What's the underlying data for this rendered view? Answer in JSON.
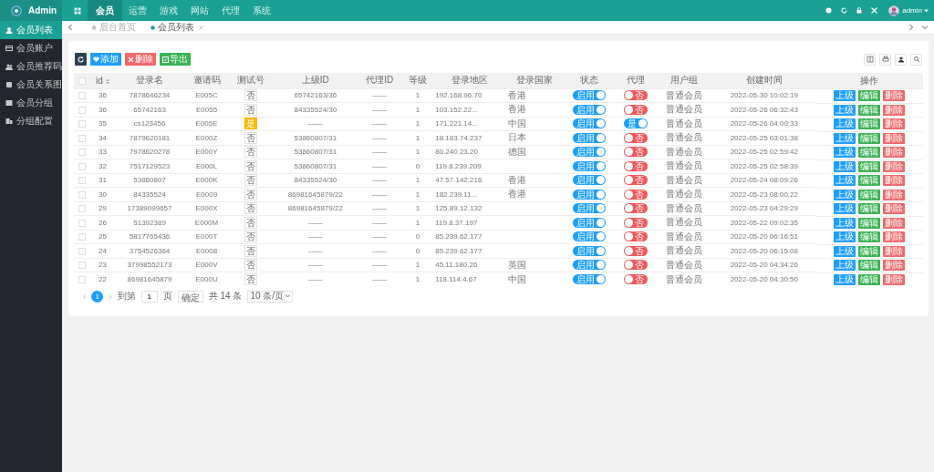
{
  "brand": {
    "title": "Admin"
  },
  "top_nav": [
    {
      "kind": "icon",
      "selected": false
    },
    {
      "label": "会员",
      "selected": true
    },
    {
      "label": "运营",
      "selected": false
    },
    {
      "label": "游戏",
      "selected": false
    },
    {
      "label": "网站",
      "selected": false
    },
    {
      "label": "代理",
      "selected": false
    },
    {
      "label": "系统",
      "selected": false
    }
  ],
  "user": {
    "name": "admin"
  },
  "sidebar": {
    "items": [
      {
        "label": "会员列表",
        "selected": true
      },
      {
        "label": "会员账户",
        "selected": false
      },
      {
        "label": "会员推荐码",
        "selected": false
      },
      {
        "label": "会员关系图",
        "selected": false
      },
      {
        "label": "会员分组",
        "selected": false
      },
      {
        "label": "分组配置",
        "selected": false
      }
    ]
  },
  "page_tabs": [
    {
      "label": "后台首页",
      "selected": false,
      "closable": false
    },
    {
      "label": "会员列表",
      "selected": true,
      "closable": true
    }
  ],
  "toolbar": [
    {
      "kind": "refresh"
    },
    {
      "kind": "primary",
      "label": "添加"
    },
    {
      "kind": "danger",
      "label": "删除"
    },
    {
      "kind": "success",
      "label": "导出"
    }
  ],
  "table": {
    "columns": [
      "id",
      "登录名",
      "邀请码",
      "测试号",
      "上级ID",
      "代理ID",
      "等级",
      "登录地区",
      "登录国家",
      "状态",
      "代理",
      "用户组",
      "创建时间",
      "操作"
    ],
    "header_checked": false,
    "rows": [
      {
        "checked": false,
        "id": "36",
        "login": "7878646234",
        "invite": "E005C",
        "test": {
          "text": "否",
          "on": false
        },
        "parent": "65742163/36",
        "agent_id": "——",
        "level": "1",
        "ip": "192.168.96.70",
        "country": "香港",
        "status": {
          "text": "启用",
          "on": true
        },
        "agent": {
          "text": "否",
          "on": false
        },
        "group": "普通会员",
        "created": "2022-05-30 10:02:19",
        "actions": [
          "上级",
          "编辑",
          "删除"
        ]
      },
      {
        "checked": false,
        "id": "36",
        "login": "65742163",
        "invite": "E0055",
        "test": {
          "text": "否",
          "on": false
        },
        "parent": "84335524/30",
        "agent_id": "——",
        "level": "1",
        "ip": "103.152.22...",
        "country": "香港",
        "status": {
          "text": "启用",
          "on": true
        },
        "agent": {
          "text": "否",
          "on": false
        },
        "group": "普通会员",
        "created": "2022-05-26 06:32:43",
        "actions": [
          "上级",
          "编辑",
          "删除"
        ]
      },
      {
        "checked": false,
        "id": "35",
        "login": "cs123456",
        "invite": "E005E",
        "test": {
          "text": "是",
          "on": true
        },
        "parent": "——",
        "agent_id": "——",
        "level": "1",
        "ip": "171.221.14...",
        "country": "中国",
        "status": {
          "text": "启用",
          "on": true
        },
        "agent": {
          "text": "是",
          "on": true
        },
        "group": "普通会员",
        "created": "2022-05-26 04:00:33",
        "actions": [
          "上级",
          "编辑",
          "删除"
        ]
      },
      {
        "checked": false,
        "id": "34",
        "login": "7879620181",
        "invite": "E000Z",
        "test": {
          "text": "否",
          "on": false
        },
        "parent": "53860807/31",
        "agent_id": "——",
        "level": "1",
        "ip": "18.183.74.237",
        "country": "日本",
        "status": {
          "text": "启用",
          "on": true
        },
        "agent": {
          "text": "否",
          "on": false
        },
        "group": "普通会员",
        "created": "2022-05-25 03:01:38",
        "actions": [
          "上级",
          "编辑",
          "删除"
        ]
      },
      {
        "checked": false,
        "id": "33",
        "login": "7978620278",
        "invite": "E000Y",
        "test": {
          "text": "否",
          "on": false
        },
        "parent": "53860807/31",
        "agent_id": "——",
        "level": "1",
        "ip": "80.240.23.20",
        "country": "德国",
        "status": {
          "text": "启用",
          "on": true
        },
        "agent": {
          "text": "否",
          "on": false
        },
        "group": "普通会员",
        "created": "2022-05-25 02:59:42",
        "actions": [
          "上级",
          "编辑",
          "删除"
        ]
      },
      {
        "checked": false,
        "id": "32",
        "login": "7517129523",
        "invite": "E000L",
        "test": {
          "text": "否",
          "on": false
        },
        "parent": "53860807/31",
        "agent_id": "——",
        "level": "0",
        "ip": "119.8.239.209",
        "status": {
          "text": "启用",
          "on": true
        },
        "agent": {
          "text": "否",
          "on": false
        },
        "group": "普通会员",
        "created": "2022-05-25 02:58:39",
        "actions": [
          "上级",
          "编辑",
          "删除"
        ]
      },
      {
        "checked": false,
        "id": "31",
        "login": "53860807",
        "invite": "E000K",
        "test": {
          "text": "否",
          "on": false
        },
        "parent": "84335524/30",
        "agent_id": "——",
        "level": "1",
        "ip": "47.57.142.216",
        "country": "香港",
        "status": {
          "text": "启用",
          "on": true
        },
        "agent": {
          "text": "否",
          "on": false
        },
        "group": "普通会员",
        "created": "2022-05-24 08:09:26",
        "actions": [
          "上级",
          "编辑",
          "删除"
        ]
      },
      {
        "checked": false,
        "id": "30",
        "login": "84335524",
        "invite": "E0009",
        "test": {
          "text": "否",
          "on": false
        },
        "parent": "86981645879/22",
        "agent_id": "——",
        "level": "1",
        "ip": "182.239.11...",
        "country": "香港",
        "status": {
          "text": "启用",
          "on": true
        },
        "agent": {
          "text": "否",
          "on": false
        },
        "group": "普通会员",
        "created": "2022-05-23 08:00:22",
        "actions": [
          "上级",
          "编辑",
          "删除"
        ]
      },
      {
        "checked": false,
        "id": "29",
        "login": "17389099657",
        "invite": "E000X",
        "test": {
          "text": "否",
          "on": false
        },
        "parent": "86981645879/22",
        "agent_id": "——",
        "level": "1",
        "ip": "125.89.12.132",
        "status": {
          "text": "启用",
          "on": true
        },
        "agent": {
          "text": "否",
          "on": false
        },
        "group": "普通会员",
        "created": "2022-05-23 04:29:29",
        "actions": [
          "上级",
          "编辑",
          "删除"
        ]
      },
      {
        "checked": false,
        "id": "26",
        "login": "51392389",
        "invite": "E000M",
        "test": {
          "text": "否",
          "on": false
        },
        "parent": "——",
        "agent_id": "——",
        "level": "1",
        "ip": "119.8.37.197",
        "status": {
          "text": "启用",
          "on": true
        },
        "agent": {
          "text": "否",
          "on": false
        },
        "group": "普通会员",
        "created": "2022-05-22 09:02:35",
        "actions": [
          "上级",
          "编辑",
          "删除"
        ]
      },
      {
        "checked": false,
        "id": "25",
        "login": "5817765436",
        "invite": "E000T",
        "test": {
          "text": "否",
          "on": false
        },
        "parent": "——",
        "agent_id": "——",
        "level": "0",
        "ip": "85.239.62.177",
        "status": {
          "text": "启用",
          "on": true
        },
        "agent": {
          "text": "否",
          "on": false
        },
        "group": "普通会员",
        "created": "2022-05-20 06:16:51",
        "actions": [
          "上级",
          "编辑",
          "删除"
        ]
      },
      {
        "checked": false,
        "id": "24",
        "login": "3754526364",
        "invite": "E0008",
        "test": {
          "text": "否",
          "on": false
        },
        "parent": "——",
        "agent_id": "——",
        "level": "0",
        "ip": "85.239.62.177",
        "status": {
          "text": "启用",
          "on": true
        },
        "agent": {
          "text": "否",
          "on": false
        },
        "group": "普通会员",
        "created": "2022-05-20 06:15:08",
        "actions": [
          "上级",
          "编辑",
          "删除"
        ]
      },
      {
        "checked": false,
        "id": "23",
        "login": "37998552173",
        "invite": "E000V",
        "test": {
          "text": "否",
          "on": false
        },
        "parent": "——",
        "agent_id": "——",
        "level": "1",
        "ip": "45.11.180.26",
        "country": "英国",
        "status": {
          "text": "启用",
          "on": true
        },
        "agent": {
          "text": "否",
          "on": false
        },
        "group": "普通会员",
        "created": "2022-05-20 04:34:26",
        "actions": [
          "上级",
          "编辑",
          "删除"
        ]
      },
      {
        "checked": false,
        "id": "22",
        "login": "86981645879",
        "invite": "E000U",
        "test": {
          "text": "否",
          "on": false
        },
        "parent": "——",
        "agent_id": "——",
        "level": "1",
        "ip": "118.114.4.67",
        "country": "中国",
        "status": {
          "text": "启用",
          "on": true
        },
        "agent": {
          "text": "否",
          "on": false
        },
        "group": "普通会员",
        "created": "2022-05-20 04:30:50",
        "actions": [
          "上级",
          "编辑",
          "删除"
        ]
      }
    ]
  },
  "pagination": {
    "prev": "‹",
    "pages": [
      {
        "label": "1",
        "selected": true
      }
    ],
    "next": "›",
    "goto_label": "到第",
    "goto_value": "1",
    "goto_unit": "页",
    "confirm": "确定",
    "total": "共 14 条",
    "page_size": "10 条/页"
  }
}
